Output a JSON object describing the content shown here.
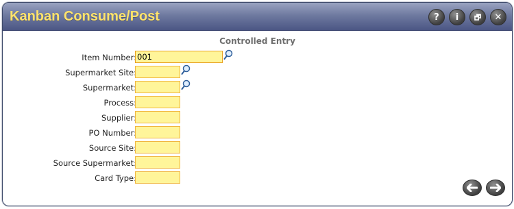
{
  "window": {
    "title": "Kanban Consume/Post",
    "controls": [
      {
        "name": "help-icon",
        "glyph": "?"
      },
      {
        "name": "info-icon",
        "glyph": "i"
      },
      {
        "name": "restore-icon",
        "glyph": "🗗"
      },
      {
        "name": "close-icon",
        "glyph": "✕"
      }
    ]
  },
  "form": {
    "section_title": "Controlled Entry",
    "fields": [
      {
        "label": "Item Number:",
        "value": "001",
        "lookup": true
      },
      {
        "label": "Supermarket Site:",
        "value": "",
        "lookup": true
      },
      {
        "label": "Supermarket:",
        "value": "",
        "lookup": true
      },
      {
        "label": "Process:",
        "value": "",
        "lookup": false
      },
      {
        "label": "Supplier:",
        "value": "",
        "lookup": false
      },
      {
        "label": "PO Number:",
        "value": "",
        "lookup": false
      },
      {
        "label": "Source Site:",
        "value": "",
        "lookup": false
      },
      {
        "label": "Source Supermarket:",
        "value": "",
        "lookup": false
      },
      {
        "label": "Card Type:",
        "value": "",
        "lookup": false
      }
    ]
  },
  "navigation": {
    "back_icon": "arrow-left-icon",
    "forward_icon": "arrow-right-icon"
  },
  "colors": {
    "title_text": "#ffe36b",
    "field_background": "#fff59a",
    "field_border": "#f0b640"
  }
}
